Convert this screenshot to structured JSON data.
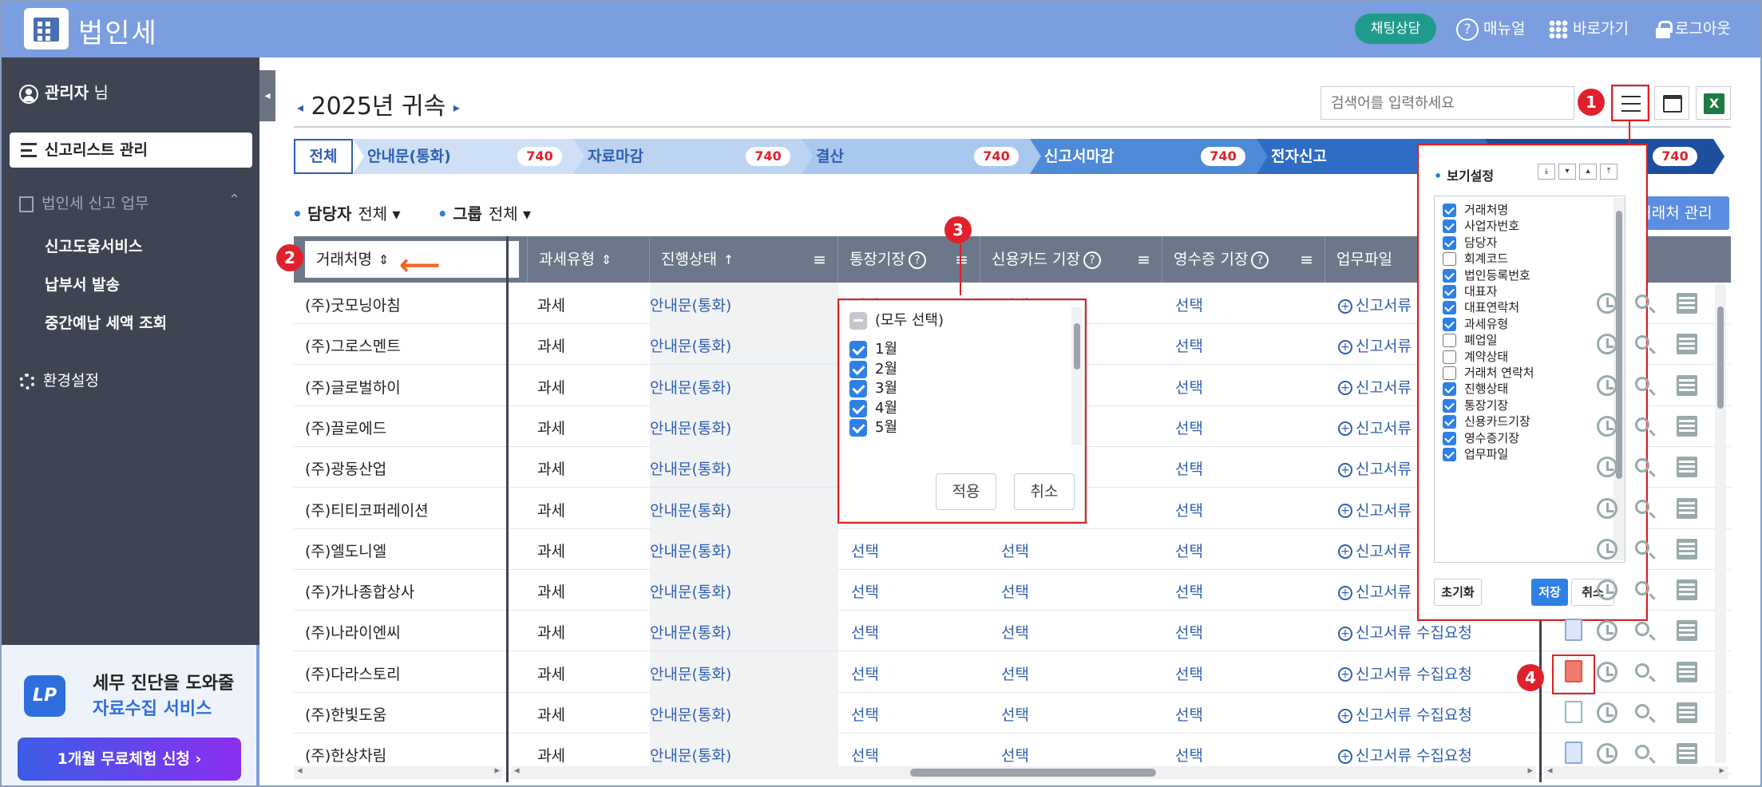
{
  "header": {
    "title": "법인세",
    "chat": "채팅상담",
    "manual": "매뉴얼",
    "shortcut": "바로가기",
    "logout": "로그아웃",
    "bg": "#7b9ee0"
  },
  "sidebar": {
    "collapse": "◂",
    "admin_name": "관리자",
    "admin_suffix": " 님",
    "active": "신고리스트 관리",
    "group": "법인세 신고 업무",
    "group_chev": "⌃",
    "subs": [
      "신고도움서비스",
      "납부서 발송",
      "중간예납 세액 조회"
    ],
    "settings": "환경설정",
    "promo": {
      "logo": "LP",
      "line1": "세무 진단을 도와줄",
      "line2": "자료수집 서비스",
      "button": "1개월 무료체험 신청  ›"
    }
  },
  "main": {
    "year": "2025년 귀속",
    "year_prev": "◂",
    "year_next": "▸",
    "search_placeholder": "검색어를 입력하세요",
    "excel": "X",
    "steps": {
      "all": "전체",
      "items": [
        {
          "label": "안내문(통화)",
          "count": "740",
          "color": "#cfe0f6",
          "text": "#2f5fb0"
        },
        {
          "label": "자료마감",
          "count": "740",
          "color": "#bcd4f2",
          "text": "#2f5fb0"
        },
        {
          "label": "결산",
          "count": "740",
          "color": "#a9c8ee",
          "text": "#2f5fb0"
        },
        {
          "label": "신고서마감",
          "count": "740",
          "color": "#4d8ad8",
          "text": "#ffffff"
        },
        {
          "label": "전자신고",
          "count": "740",
          "color": "#2f6cc6",
          "text": "#ffffff"
        },
        {
          "label": "",
          "count": "740",
          "color": "#1d4f9e",
          "text": "#ffffff"
        }
      ]
    },
    "filters": {
      "dot": "•",
      "manager_label": "담당자",
      "manager_value": "전체 ▾",
      "group_label": "그룹",
      "group_value": "전체 ▾"
    },
    "client_button": "거래처 관리",
    "columns": {
      "name": "거래처명",
      "tax": "과세유형",
      "status": "진행상태",
      "bank": "통장기장",
      "card": "신용카드 기장",
      "receipt": "영수증 기장",
      "file": "업무파일"
    },
    "icons": {
      "sort": "⇕",
      "sort_up": "↑",
      "filter": "≡",
      "help": "?",
      "plus": "+",
      "left": "◂",
      "right": "▸",
      "up": "▴",
      "down": "▾",
      "top": "⤒",
      "bottom": "⤓"
    },
    "rows": [
      {
        "name": "(주)굿모닝아침",
        "tax": "과세",
        "status": "안내문(통화)",
        "bank": "선택",
        "card": "선택",
        "receipt": "선택",
        "file": "신고서류",
        "doc": "none"
      },
      {
        "name": "(주)그로스멘트",
        "tax": "과세",
        "status": "안내문(통화)",
        "bank": "선택",
        "card": "선택",
        "receipt": "선택",
        "file": "신고서류",
        "doc": "none"
      },
      {
        "name": "(주)글로벌하이",
        "tax": "과세",
        "status": "안내문(통화)",
        "bank": "선택",
        "card": "선택",
        "receipt": "선택",
        "file": "신고서류",
        "doc": "none"
      },
      {
        "name": "(주)끌로에드",
        "tax": "과세",
        "status": "안내문(통화)",
        "bank": "선택",
        "card": "선택",
        "receipt": "선택",
        "file": "신고서류",
        "doc": "none"
      },
      {
        "name": "(주)광동산업",
        "tax": "과세",
        "status": "안내문(통화)",
        "bank": "선택",
        "card": "선택",
        "receipt": "선택",
        "file": "신고서류",
        "doc": "none"
      },
      {
        "name": "(주)티티코퍼레이션",
        "tax": "과세",
        "status": "안내문(통화)",
        "bank": "선택",
        "card": "선택",
        "receipt": "선택",
        "file": "신고서류",
        "doc": "none"
      },
      {
        "name": "(주)엘도니엘",
        "tax": "과세",
        "status": "안내문(통화)",
        "bank": "선택",
        "card": "선택",
        "receipt": "선택",
        "file": "신고서류",
        "doc": "none"
      },
      {
        "name": "(주)가나종합상사",
        "tax": "과세",
        "status": "안내문(통화)",
        "bank": "선택",
        "card": "선택",
        "receipt": "선택",
        "file": "신고서류",
        "doc": "none"
      },
      {
        "name": "(주)나라이엔씨",
        "tax": "과세",
        "status": "안내문(통화)",
        "bank": "선택",
        "card": "선택",
        "receipt": "선택",
        "file": "신고서류 수집요청",
        "doc": "blue"
      },
      {
        "name": "(주)다라스토리",
        "tax": "과세",
        "status": "안내문(통화)",
        "bank": "선택",
        "card": "선택",
        "receipt": "선택",
        "file": "신고서류 수집요청",
        "doc": "red"
      },
      {
        "name": "(주)한빛도움",
        "tax": "과세",
        "status": "안내문(통화)",
        "bank": "선택",
        "card": "선택",
        "receipt": "선택",
        "file": "신고서류 수집요청",
        "doc": "plain"
      },
      {
        "name": "(주)한상차림",
        "tax": "과세",
        "status": "안내문(통화)",
        "bank": "선택",
        "card": "선택",
        "receipt": "선택",
        "file": "신고서류 수집요청",
        "doc": "blue"
      }
    ],
    "badges": [
      "1",
      "2",
      "3",
      "4"
    ]
  },
  "month_filter": {
    "all": "(모두 선택)",
    "items": [
      "1월",
      "2월",
      "3월",
      "4월",
      "5월"
    ],
    "apply": "적용",
    "cancel": "취소"
  },
  "view_settings": {
    "title": "보기설정",
    "items": [
      {
        "label": "거래처명",
        "on": true
      },
      {
        "label": "사업자번호",
        "on": true
      },
      {
        "label": "담당자",
        "on": true
      },
      {
        "label": "회계코드",
        "on": false
      },
      {
        "label": "법인등록번호",
        "on": true
      },
      {
        "label": "대표자",
        "on": true
      },
      {
        "label": "대표연락처",
        "on": true
      },
      {
        "label": "과세유형",
        "on": true
      },
      {
        "label": "폐업일",
        "on": false
      },
      {
        "label": "계약상태",
        "on": false
      },
      {
        "label": "거래처 연락처",
        "on": false
      },
      {
        "label": "진행상태",
        "on": true
      },
      {
        "label": "통장기장",
        "on": true
      },
      {
        "label": "신용카드기장",
        "on": true
      },
      {
        "label": "영수증기장",
        "on": true
      },
      {
        "label": "업무파일",
        "on": true
      }
    ],
    "reset": "초기화",
    "save": "저장",
    "cancel": "취소"
  },
  "colors": {
    "accent": "#2f5fb0",
    "badge": "#e0212d",
    "highlight": "#e02020",
    "checkbox": "#2f80e6"
  }
}
